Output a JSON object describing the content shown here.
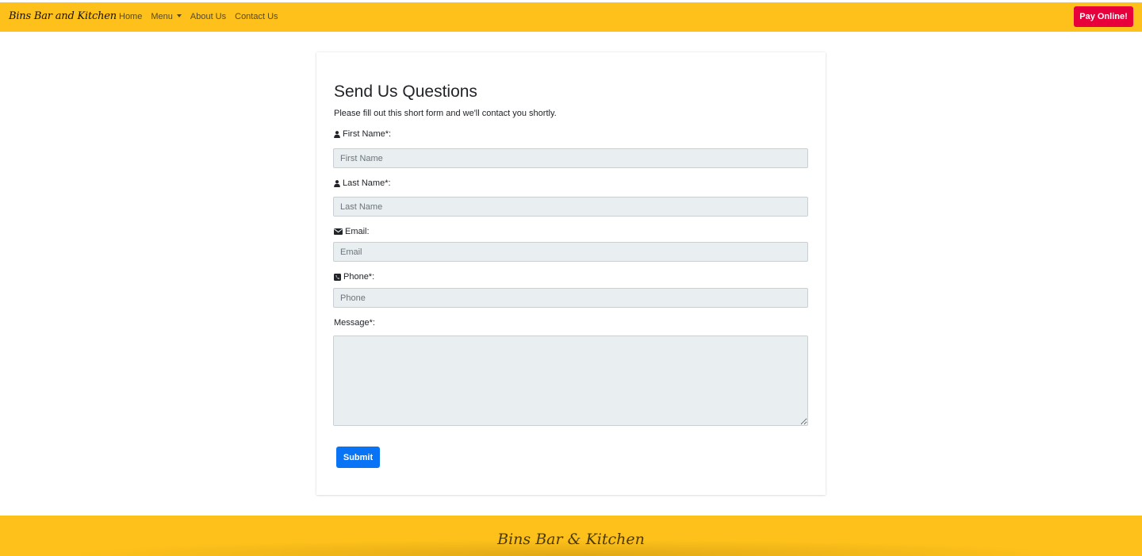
{
  "navbar": {
    "brand": "Bins Bar and Kitchen",
    "links": [
      "Home",
      "Menu",
      "About Us",
      "Contact Us"
    ],
    "pay_button": "Pay Online!"
  },
  "form": {
    "title": "Send Us Questions",
    "subtitle": "Please fill out this short form and we'll contact you shortly.",
    "first_name": {
      "label": "First Name*:",
      "placeholder": "First Name",
      "value": ""
    },
    "last_name": {
      "label": "Last Name*:",
      "placeholder": "Last Name",
      "value": ""
    },
    "email": {
      "label": "Email:",
      "placeholder": "Email",
      "value": ""
    },
    "phone": {
      "label": "Phone*:",
      "placeholder": "Phone",
      "value": ""
    },
    "message": {
      "label": "Message*:",
      "value": ""
    },
    "submit_label": "Submit"
  },
  "footer": {
    "brand": "Bins Bar & Kitchen"
  },
  "colors": {
    "navbar_bg": "#fec11b",
    "pay_button": "#e8003d",
    "submit_button": "#0874f5",
    "input_bg": "#e9eef0"
  },
  "icons": {
    "first_name": "user-icon",
    "last_name": "user-icon",
    "email": "envelope-icon",
    "phone": "phone-square-icon"
  }
}
